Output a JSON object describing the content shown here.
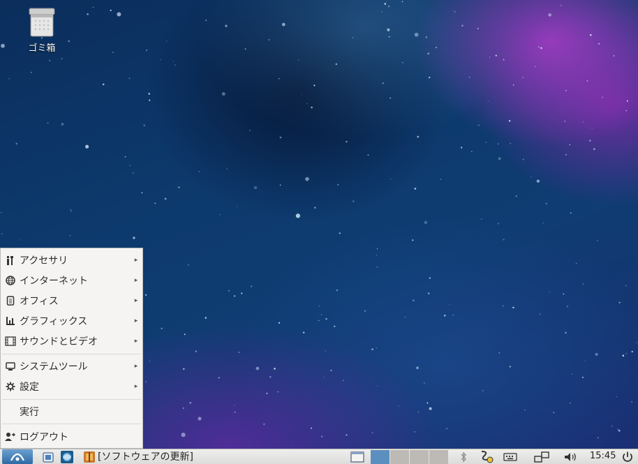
{
  "desktop": {
    "trash_label": "ゴミ箱"
  },
  "menu": {
    "items": [
      {
        "label": "アクセサリ",
        "icon": "accessories-icon",
        "submenu": true
      },
      {
        "label": "インターネット",
        "icon": "internet-globe-icon",
        "submenu": true
      },
      {
        "label": "オフィス",
        "icon": "office-document-icon",
        "submenu": true
      },
      {
        "label": "グラフィックス",
        "icon": "graphics-icon",
        "submenu": true
      },
      {
        "label": "サウンドとビデオ",
        "icon": "sound-video-icon",
        "submenu": true
      },
      {
        "label": "システムツール",
        "icon": "monitor-icon",
        "submenu": true
      },
      {
        "label": "設定",
        "icon": "gear-icon",
        "submenu": true
      },
      {
        "label": "実行",
        "icon": "",
        "submenu": false
      },
      {
        "label": "ログアウト",
        "icon": "logout-user-icon",
        "submenu": false
      }
    ],
    "arrow_glyph": "▸"
  },
  "taskbar": {
    "task_title": "[ソフトウェアの更新]",
    "clock": "15:45",
    "workspace_colors": [
      "#5b8fbf",
      "#bdbab5",
      "#bdbab5",
      "#bdbab5"
    ]
  }
}
